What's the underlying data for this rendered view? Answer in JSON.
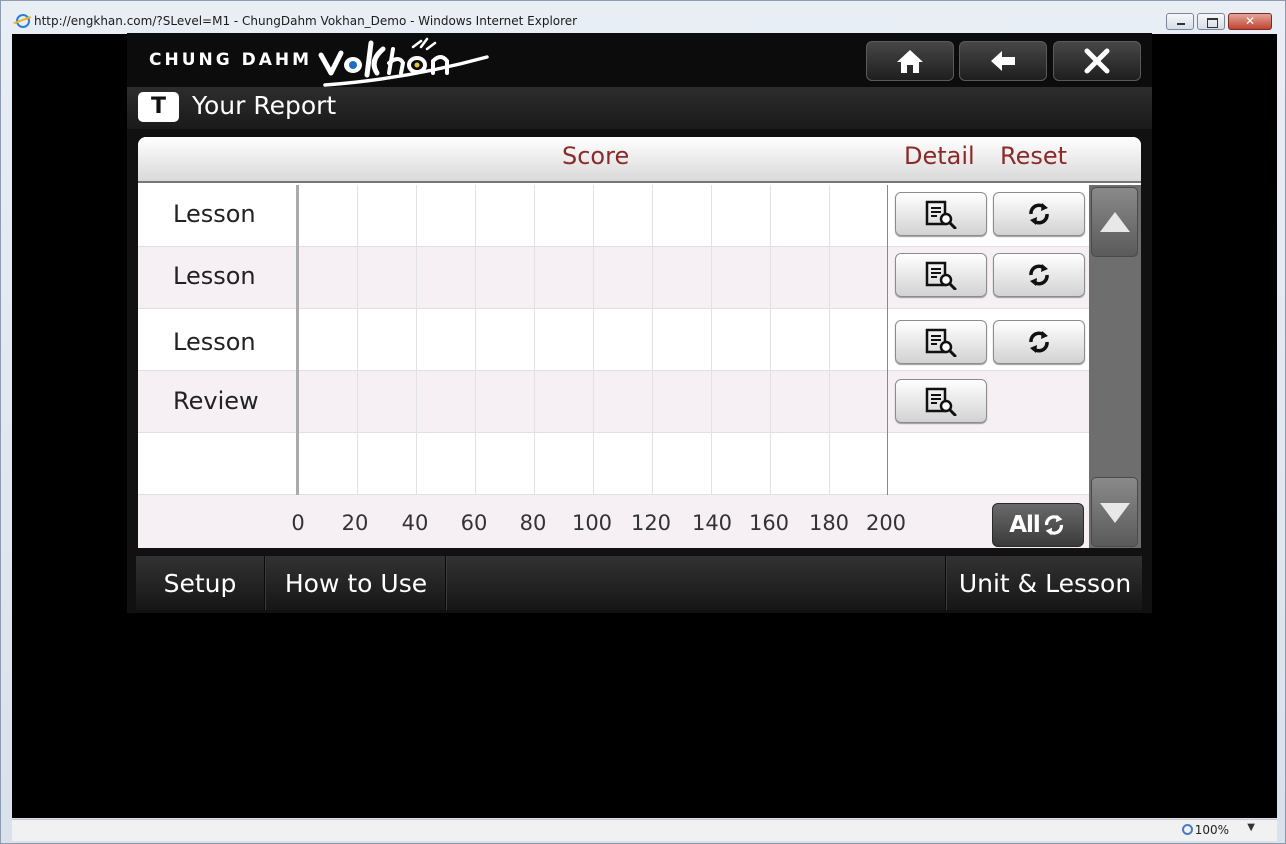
{
  "browser": {
    "title": "http://engkhan.com/?SLevel=M1 - ChungDahm Vokhan_Demo - Windows Internet Explorer",
    "zoom": "100%"
  },
  "header": {
    "brand": "CHUNG DAHM",
    "logo_text": "VoKhan"
  },
  "title_bar": {
    "badge": "T",
    "title": "Your Report"
  },
  "table": {
    "columns": {
      "score": "Score",
      "detail": "Detail",
      "reset": "Reset"
    },
    "rows": [
      {
        "label": "Lesson",
        "has_reset": true
      },
      {
        "label": "Lesson",
        "has_reset": true
      },
      {
        "label": "Lesson",
        "has_reset": true
      },
      {
        "label": "Review",
        "has_reset": false
      },
      {
        "label": "",
        "has_reset": false
      }
    ],
    "axis_ticks": [
      "0",
      "20",
      "40",
      "60",
      "80",
      "100",
      "120",
      "140",
      "160",
      "180",
      "200"
    ],
    "all_reset_label": "All"
  },
  "footer": {
    "setup": "Setup",
    "how_to_use": "How to Use",
    "unit_lesson": "Unit & Lesson"
  },
  "colors": {
    "header_label": "#8b2a2a",
    "alt_row": "#f6f0f4"
  }
}
